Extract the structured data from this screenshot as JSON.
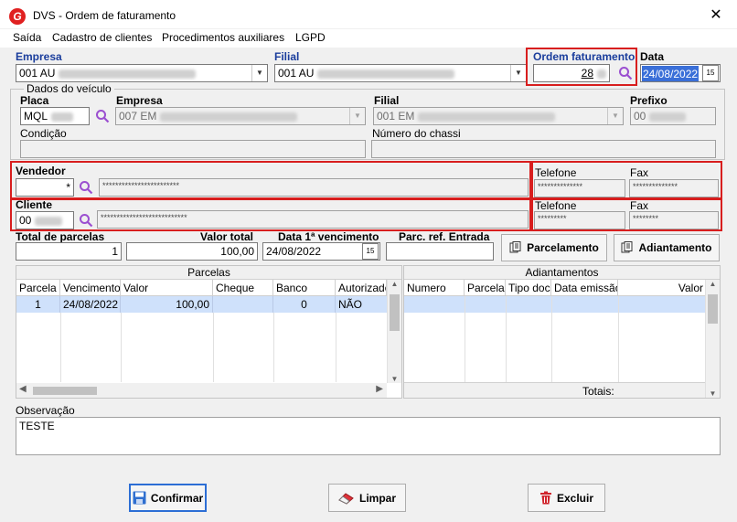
{
  "window": {
    "title": "DVS - Ordem de faturamento",
    "close": "✕"
  },
  "menu": [
    "Saída",
    "Cadastro de clientes",
    "Procedimentos auxiliares",
    "LGPD"
  ],
  "header": {
    "empresa_label": "Empresa",
    "empresa_value": "001 AU",
    "filial_label": "Filial",
    "filial_value": "001 AU",
    "ordem_label": "Ordem faturamento",
    "ordem_value": "28",
    "data_label": "Data",
    "data_value": "24/08/2022"
  },
  "veiculo": {
    "group_label": "Dados do veículo",
    "placa_label": "Placa",
    "placa_value": "MQL",
    "empresa_label": "Empresa",
    "empresa_value": "007 EM",
    "filial_label": "Filial",
    "filial_value": "001 EM",
    "prefixo_label": "Prefixo",
    "prefixo_value": "00",
    "condicao_label": "Condição",
    "condicao_value": "",
    "chassi_label": "Número do chassi",
    "chassi_value": ""
  },
  "vendedor": {
    "label": "Vendedor",
    "code": "*",
    "name": "************************",
    "telefone_label": "Telefone",
    "telefone": "**************",
    "fax_label": "Fax",
    "fax": "**************"
  },
  "cliente": {
    "label": "Cliente",
    "code": "00",
    "name": "***************************",
    "telefone_label": "Telefone",
    "telefone": "*********",
    "fax_label": "Fax",
    "fax": "********"
  },
  "totais": {
    "parcelas_label": "Total de parcelas",
    "parcelas_value": "1",
    "valor_label": "Valor total",
    "valor_value": "100,00",
    "venc_label": "Data 1ª vencimento",
    "venc_value": "24/08/2022",
    "entrada_label": "Parc. ref. Entrada",
    "entrada_value": "",
    "parcelamento_btn": "Parcelamento",
    "adiantamento_btn": "Adiantamento"
  },
  "parcelas": {
    "title": "Parcelas",
    "columns": [
      "Parcela",
      "Vencimento",
      "Valor",
      "Cheque",
      "Banco",
      "Autorizado"
    ],
    "rows": [
      {
        "parcela": "1",
        "vencimento": "24/08/2022",
        "valor": "100,00",
        "cheque": "",
        "banco": "0",
        "autorizado": "NÃO"
      }
    ]
  },
  "adiantamentos": {
    "title": "Adiantamentos",
    "columns": [
      "Numero",
      "Parcela",
      "Tipo doc",
      "Data emissão",
      "Valor"
    ],
    "totais_label": "Totais:"
  },
  "observacao": {
    "label": "Observação",
    "value": "TESTE"
  },
  "actions": {
    "confirmar": "Confirmar",
    "limpar": "Limpar",
    "excluir": "Excluir"
  },
  "colors": {
    "highlight": "#d81e1e",
    "label_blue": "#1a3d9c",
    "selected_row": "#cfe1fb"
  }
}
